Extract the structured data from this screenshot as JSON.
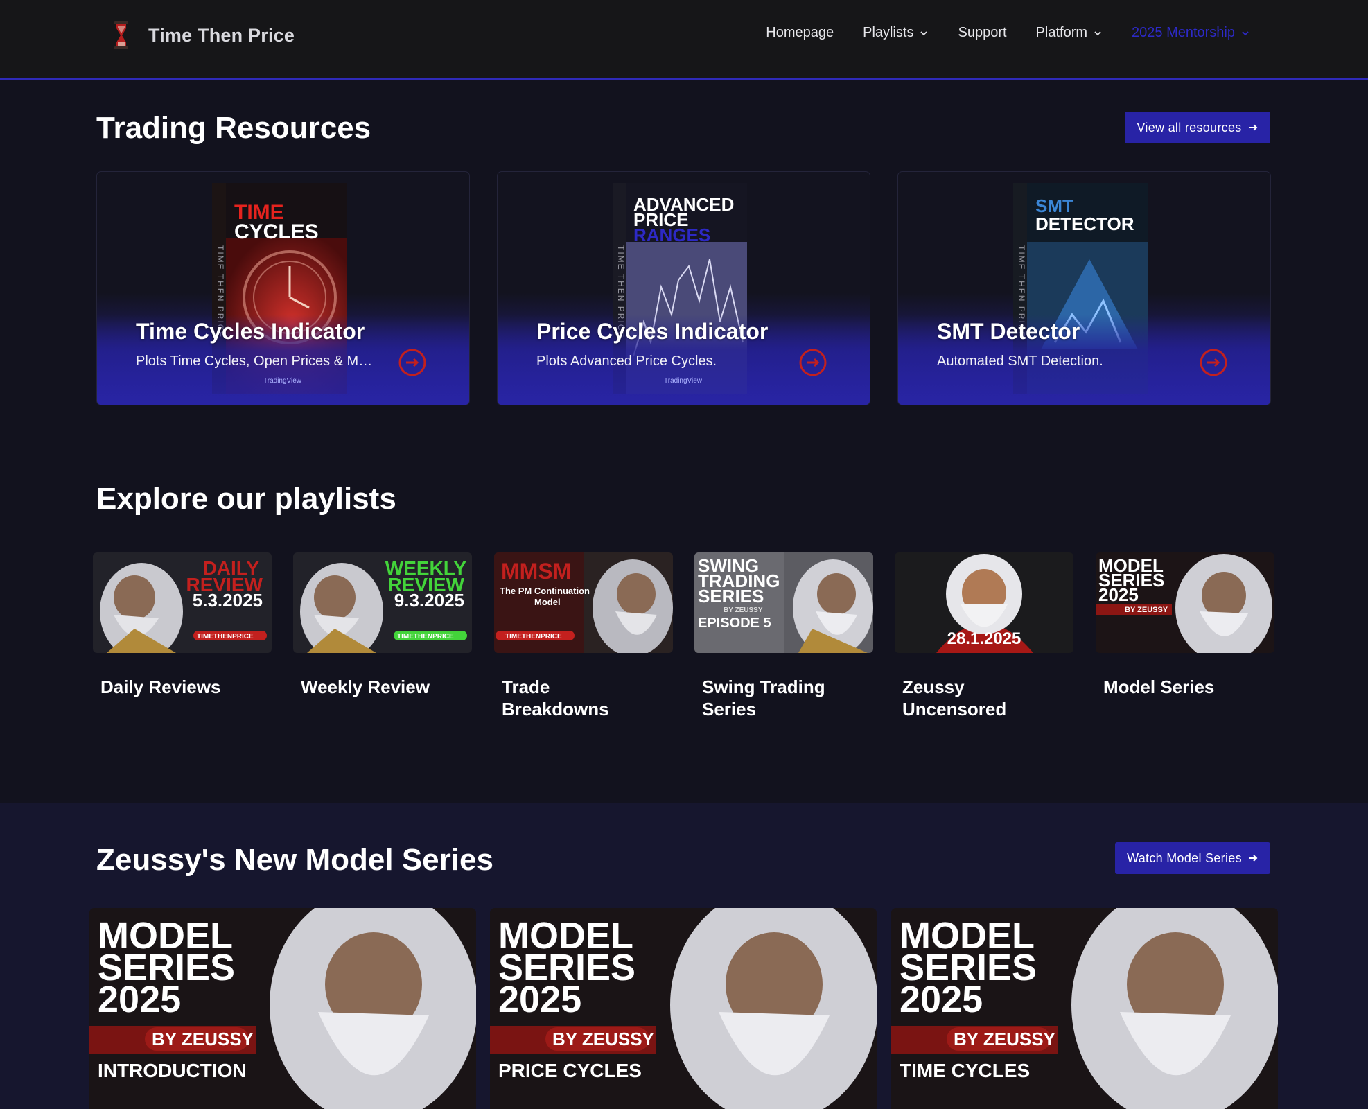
{
  "nav": {
    "brand": "Time Then Price",
    "links": [
      {
        "label": "Homepage",
        "dropdown": false
      },
      {
        "label": "Playlists",
        "dropdown": true
      },
      {
        "label": "Support",
        "dropdown": false
      },
      {
        "label": "Platform",
        "dropdown": true
      },
      {
        "label": "2025 Mentorship",
        "dropdown": true
      }
    ]
  },
  "resources": {
    "heading": "Trading Resources",
    "button": "View all resources",
    "items": [
      {
        "title": "Time Cycles Indicator",
        "desc": "Plots Time Cycles, Open Prices & More.",
        "cover_l1": "TIME",
        "cover_l2": "CYCLES",
        "spine": "TIME THEN PRICE",
        "badge": "TradingView",
        "icon": "clock-icon"
      },
      {
        "title": "Price Cycles Indicator",
        "desc": "Plots Advanced Price Cycles.",
        "cover_l1": "ADVANCED",
        "cover_l2": "PRICE",
        "cover_l3": "RANGES",
        "spine": "TIME THEN PRICE",
        "badge": "TradingView",
        "icon": "chart-icon"
      },
      {
        "title": "SMT Detector",
        "desc": "Automated SMT Detection.",
        "cover_l1": "SMT",
        "cover_l2": "DETECTOR",
        "spine": "TIME THEN PRICE",
        "icon": "pyramid-icon"
      }
    ]
  },
  "playlists": {
    "heading": "Explore our playlists",
    "items": [
      {
        "name": "Daily Reviews",
        "thumb_l1": "DAILY",
        "thumb_l2": "REVIEW",
        "thumb_date": "5.3.2025",
        "thumb_tag": "TIMETHENPRICE"
      },
      {
        "name": "Weekly Review",
        "thumb_l1": "WEEKLY",
        "thumb_l2": "REVIEW",
        "thumb_date": "9.3.2025",
        "thumb_tag": "TIMETHENPRICE"
      },
      {
        "name": "Trade Breakdowns",
        "thumb_l1": "MMSM",
        "thumb_l2": "The PM Continuation",
        "thumb_l3": "Model",
        "thumb_tag": "TIMETHENPRICE"
      },
      {
        "name": "Swing Trading Series",
        "thumb_l1": "SWING",
        "thumb_l2": "TRADING",
        "thumb_l3": "SERIES",
        "thumb_by": "BY ZEUSSY",
        "thumb_ep": "EPISODE 5"
      },
      {
        "name": "Zeussy Uncensored",
        "thumb_date": "28.1.2025"
      },
      {
        "name": "Model Series",
        "thumb_l1": "MODEL",
        "thumb_l2": "SERIES",
        "thumb_l3": "2025",
        "thumb_by": "BY ZEUSSY"
      }
    ]
  },
  "model_series": {
    "heading": "Zeussy's New Model Series",
    "button": "Watch Model Series",
    "items": [
      {
        "l1": "MODEL",
        "l2": "SERIES",
        "l3": "2025",
        "by": "BY ZEUSSY",
        "sub": "INTRODUCTION"
      },
      {
        "l1": "MODEL",
        "l2": "SERIES",
        "l3": "2025",
        "by": "BY ZEUSSY",
        "sub": "PRICE CYCLES"
      },
      {
        "l1": "MODEL",
        "l2": "SERIES",
        "l3": "2025",
        "by": "BY ZEUSSY",
        "sub": "TIME CYCLES"
      }
    ]
  },
  "colors": {
    "accent": "#2823a6",
    "nav_accent": "#2d2ac8",
    "brand_red": "#c3201e",
    "background": "#12121e"
  },
  "icons": [
    "hourglass-logo-icon",
    "chevron-down-icon",
    "arrow-right-icon",
    "circle-arrow-right-icon"
  ]
}
